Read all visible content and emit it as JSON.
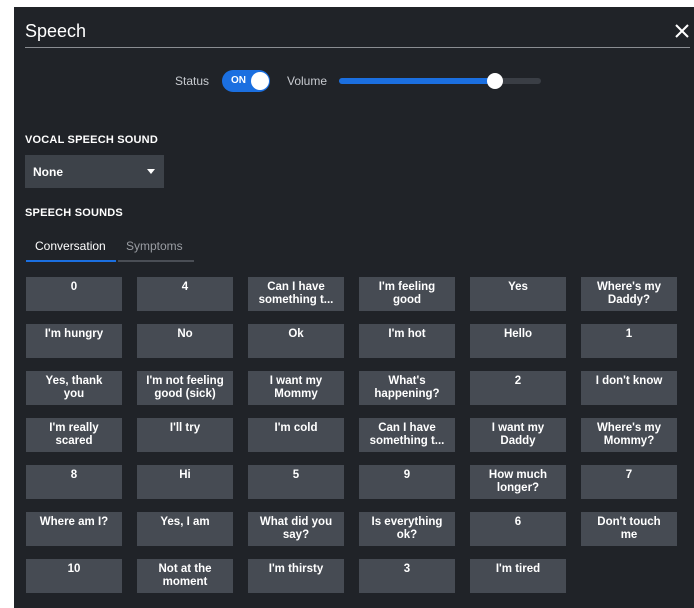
{
  "header": {
    "title": "Speech",
    "close_icon": "close-icon"
  },
  "controls": {
    "status_label": "Status",
    "status_toggle_text": "ON",
    "status_on": true,
    "volume_label": "Volume",
    "volume_level": 0.77
  },
  "vocal": {
    "heading": "VOCAL SPEECH SOUND",
    "selected": "None"
  },
  "speech": {
    "heading": "SPEECH SOUNDS",
    "tabs": [
      {
        "label": "Conversation",
        "active": true
      },
      {
        "label": "Symptoms",
        "active": false
      }
    ],
    "buttons": [
      "0",
      "4",
      "Can I have\nsomething t...",
      "I'm feeling\ngood",
      "Yes",
      "Where's my\nDaddy?",
      "I'm hungry",
      "No",
      "Ok",
      "I'm hot",
      "Hello",
      "1",
      "Yes, thank\nyou",
      "I'm not feeling\ngood (sick)",
      "I want my\nMommy",
      "What's\nhappening?",
      "2",
      "I don't know",
      "I'm really\nscared",
      "I'll try",
      "I'm cold",
      "Can I have\nsomething t...",
      "I want my\nDaddy",
      "Where's my\nMommy?",
      "8",
      "Hi",
      "5",
      "9",
      "How much\nlonger?",
      "7",
      "Where am I?",
      "Yes, I am",
      "What did you\nsay?",
      "Is everything\nok?",
      "6",
      "Don't touch\nme",
      "10",
      "Not at the\nmoment",
      "I'm thirsty",
      "3",
      "I'm tired"
    ]
  },
  "colors": {
    "panel_bg": "#202328",
    "button_bg": "#464b53",
    "accent": "#1b6fe0"
  }
}
